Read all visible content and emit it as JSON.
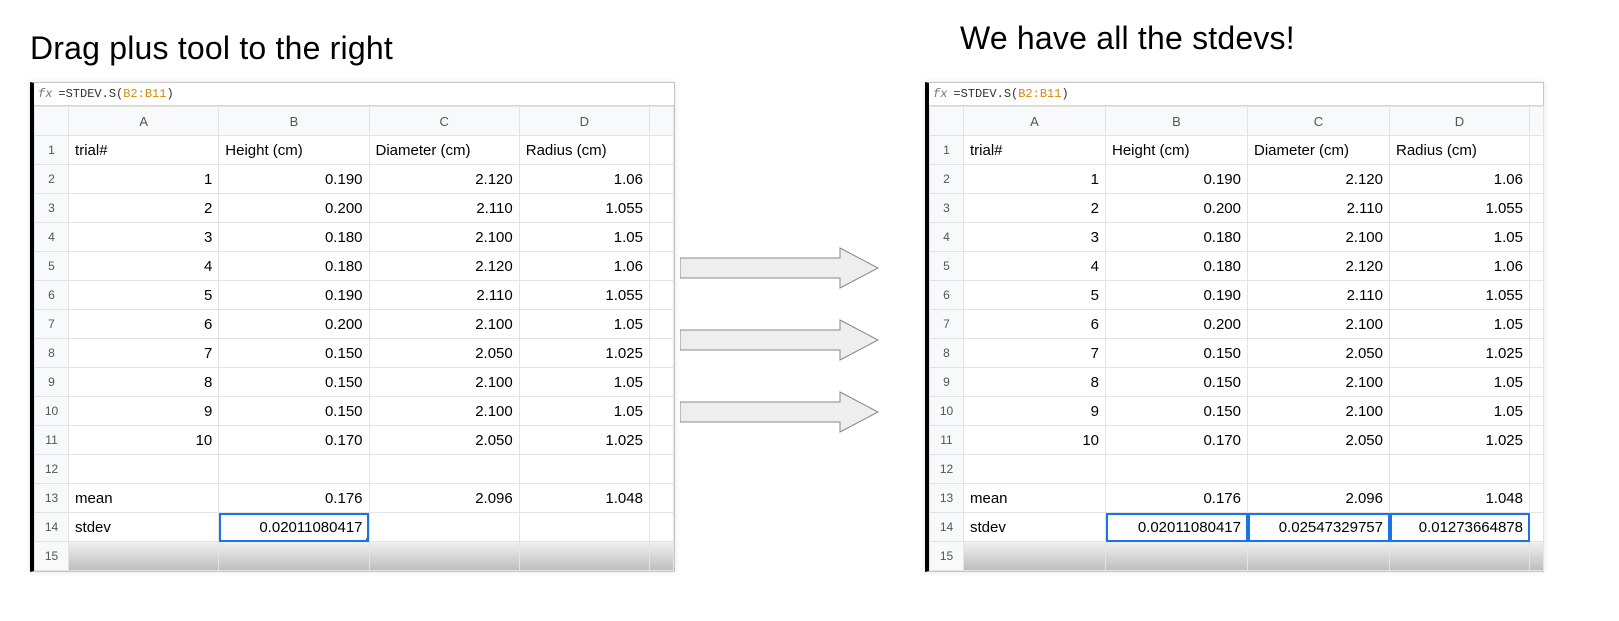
{
  "captions": {
    "left": "Drag plus tool to the right",
    "right": "We have all the stdevs!"
  },
  "formula": {
    "prefix": "=STDEV.S(",
    "ref": "B2:B11",
    "suffix": ")"
  },
  "columns": [
    "A",
    "B",
    "C",
    "D"
  ],
  "headers": {
    "A": "trial#",
    "B": "Height (cm)",
    "C": "Diameter (cm)",
    "D": "Radius (cm)"
  },
  "data": [
    {
      "r": 2,
      "A": "1",
      "B": "0.190",
      "C": "2.120",
      "D": "1.06"
    },
    {
      "r": 3,
      "A": "2",
      "B": "0.200",
      "C": "2.110",
      "D": "1.055"
    },
    {
      "r": 4,
      "A": "3",
      "B": "0.180",
      "C": "2.100",
      "D": "1.05"
    },
    {
      "r": 5,
      "A": "4",
      "B": "0.180",
      "C": "2.120",
      "D": "1.06"
    },
    {
      "r": 6,
      "A": "5",
      "B": "0.190",
      "C": "2.110",
      "D": "1.055"
    },
    {
      "r": 7,
      "A": "6",
      "B": "0.200",
      "C": "2.100",
      "D": "1.05"
    },
    {
      "r": 8,
      "A": "7",
      "B": "0.150",
      "C": "2.050",
      "D": "1.025"
    },
    {
      "r": 9,
      "A": "8",
      "B": "0.150",
      "C": "2.100",
      "D": "1.05"
    },
    {
      "r": 10,
      "A": "9",
      "B": "0.150",
      "C": "2.100",
      "D": "1.05"
    },
    {
      "r": 11,
      "A": "10",
      "B": "0.170",
      "C": "2.050",
      "D": "1.025"
    }
  ],
  "mean": {
    "label": "mean",
    "B": "0.176",
    "C": "2.096",
    "D": "1.048"
  },
  "stdev_left": {
    "label": "stdev",
    "B": "0.02011080417",
    "C": "",
    "D": ""
  },
  "stdev_right": {
    "label": "stdev",
    "B": "0.02011080417",
    "C": "0.02547329757",
    "D": "0.01273664878"
  }
}
